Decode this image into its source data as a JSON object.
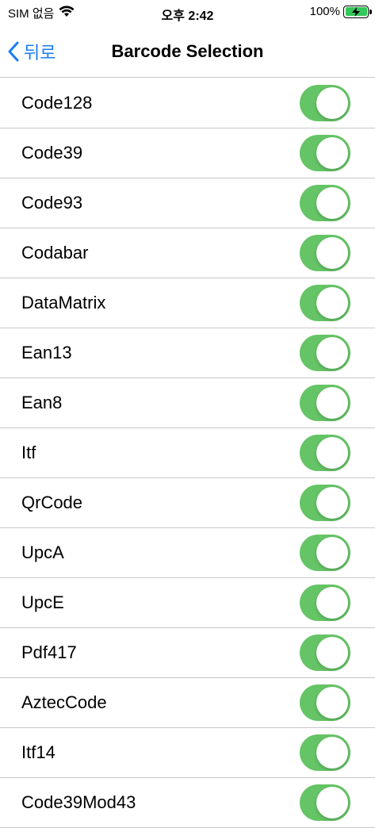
{
  "status_bar": {
    "carrier": "SIM 없음",
    "time": "오후 2:42",
    "battery_percent": "100%"
  },
  "nav": {
    "back_label": "뒤로",
    "title": "Barcode Selection"
  },
  "colors": {
    "accent": "#1a7cf5",
    "toggle_on": "#65c466",
    "separator": "#c8c7cc"
  },
  "barcodes": [
    {
      "label": "Code128",
      "enabled": true
    },
    {
      "label": "Code39",
      "enabled": true
    },
    {
      "label": "Code93",
      "enabled": true
    },
    {
      "label": "Codabar",
      "enabled": true
    },
    {
      "label": "DataMatrix",
      "enabled": true
    },
    {
      "label": "Ean13",
      "enabled": true
    },
    {
      "label": "Ean8",
      "enabled": true
    },
    {
      "label": "Itf",
      "enabled": true
    },
    {
      "label": "QrCode",
      "enabled": true
    },
    {
      "label": "UpcA",
      "enabled": true
    },
    {
      "label": "UpcE",
      "enabled": true
    },
    {
      "label": "Pdf417",
      "enabled": true
    },
    {
      "label": "AztecCode",
      "enabled": true
    },
    {
      "label": "Itf14",
      "enabled": true
    },
    {
      "label": "Code39Mod43",
      "enabled": true
    }
  ]
}
